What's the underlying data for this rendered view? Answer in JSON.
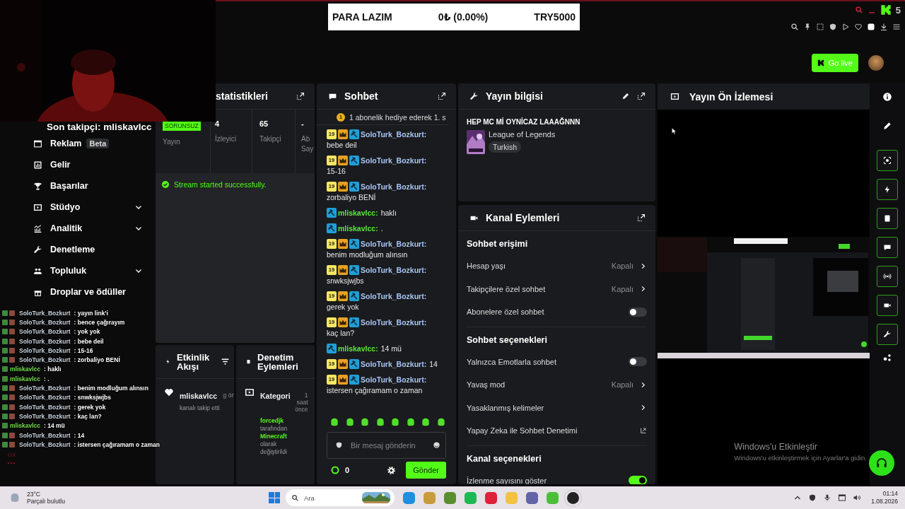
{
  "donation_goal": {
    "title": "PARA LAZIM",
    "progress": "0₺ (0.00%)",
    "goal": "TRY5000"
  },
  "browser": {
    "badge": "5"
  },
  "go_live": "Go live",
  "latest_follower": "Son takipçi: mliskavlcc",
  "sidebar": {
    "items": [
      {
        "label": "Reklam",
        "kind": "link",
        "badge": "Beta"
      },
      {
        "label": "Gelir",
        "kind": "link"
      },
      {
        "label": "Başarılar",
        "kind": "link"
      },
      {
        "label": "Stüdyo",
        "kind": "group"
      },
      {
        "label": "Analitik",
        "kind": "group"
      },
      {
        "label": "Denetleme",
        "kind": "link"
      },
      {
        "label": "Topluluk",
        "kind": "group"
      },
      {
        "label": "Droplar ve ödüller",
        "kind": "link"
      }
    ]
  },
  "stats": {
    "title": "statistikleri",
    "items": [
      {
        "kind": "status",
        "value": "SORUNSUZ",
        "label": "Yayın"
      },
      {
        "kind": "number",
        "value": "4",
        "label": "İzleyici"
      },
      {
        "kind": "number",
        "value": "65",
        "label": "Takipçi"
      },
      {
        "kind": "number",
        "value": "-",
        "label": "Ab Say"
      }
    ],
    "notice": "Stream started successfully."
  },
  "activity_feed": {
    "title": "Etkinlik Akışı",
    "events": [
      {
        "user": "mliskavlcc",
        "time": "g ön",
        "text": "kanalı takip etti"
      }
    ]
  },
  "mod_actions": {
    "title": "Denetim Eylemleri",
    "events": [
      {
        "title": "Kategori",
        "time": "1 saat önce",
        "text": "**forcedjk** tarafından **Minecraft** olarak değiştirildi"
      }
    ]
  },
  "chat": {
    "title": "Sohbet",
    "pinned": {
      "badge": "1",
      "text": "1 abonelik hediye ederek 1. s"
    },
    "messages": [
      {
        "user": "SoloTurk_Bozkurt:",
        "color": "#a9c6f5",
        "text": "bebe deil",
        "badges": [
          {
            "kind": "sub",
            "text": "19"
          },
          {
            "kind": "crown"
          },
          {
            "kind": "mod"
          }
        ]
      },
      {
        "user": "SoloTurk_Bozkurt:",
        "color": "#a9c6f5",
        "text": "15-16",
        "badges": [
          {
            "kind": "sub",
            "text": "19"
          },
          {
            "kind": "crown"
          },
          {
            "kind": "mod"
          }
        ]
      },
      {
        "user": "SoloTurk_Bozkurt:",
        "color": "#a9c6f5",
        "text": "zorbaliyo BENİ",
        "badges": [
          {
            "kind": "sub",
            "text": "19"
          },
          {
            "kind": "crown"
          },
          {
            "kind": "mod"
          }
        ]
      },
      {
        "user": "mliskavlcc:",
        "color": "#5ee83a",
        "text": "haklı",
        "badges": [
          {
            "kind": "mod"
          }
        ]
      },
      {
        "user": "mliskavlcc:",
        "color": "#5ee83a",
        "text": ".",
        "badges": [
          {
            "kind": "mod"
          }
        ]
      },
      {
        "user": "SoloTurk_Bozkurt:",
        "color": "#a9c6f5",
        "text": "benim modluğum alınsın",
        "badges": [
          {
            "kind": "sub",
            "text": "19"
          },
          {
            "kind": "crown"
          },
          {
            "kind": "mod"
          }
        ]
      },
      {
        "user": "SoloTurk_Bozkurt:",
        "color": "#a9c6f5",
        "text": "snwksjwjbs",
        "badges": [
          {
            "kind": "sub",
            "text": "19"
          },
          {
            "kind": "crown"
          },
          {
            "kind": "mod"
          }
        ]
      },
      {
        "user": "SoloTurk_Bozkurt:",
        "color": "#a9c6f5",
        "text": "gerek yok",
        "badges": [
          {
            "kind": "sub",
            "text": "19"
          },
          {
            "kind": "crown"
          },
          {
            "kind": "mod"
          }
        ]
      },
      {
        "user": "SoloTurk_Bozkurt:",
        "color": "#a9c6f5",
        "text": "kaç lan?",
        "badges": [
          {
            "kind": "sub",
            "text": "19"
          },
          {
            "kind": "crown"
          },
          {
            "kind": "mod"
          }
        ]
      },
      {
        "user": "mliskavlcc:",
        "color": "#5ee83a",
        "text": "14 mü",
        "badges": [
          {
            "kind": "mod"
          }
        ]
      },
      {
        "user": "SoloTurk_Bozkurt:",
        "color": "#a9c6f5",
        "text": "14",
        "badges": [
          {
            "kind": "sub",
            "text": "19"
          },
          {
            "kind": "crown"
          },
          {
            "kind": "mod"
          }
        ]
      },
      {
        "user": "SoloTurk_Bozkurt:",
        "color": "#a9c6f5",
        "text": "istersen çağıramam o zaman",
        "badges": [
          {
            "kind": "sub",
            "text": "19"
          },
          {
            "kind": "crown"
          },
          {
            "kind": "mod"
          }
        ]
      }
    ],
    "input": {
      "placeholder": "Bir mesaj gönderin"
    },
    "points": "0",
    "send": "Gönder"
  },
  "stream_info": {
    "title": "Yayın bilgisi",
    "stream_title": "HEP MC Mİ OYNİCAZ LAAAĞNNN",
    "category": "League of Legends",
    "tags": [
      "Turkish"
    ]
  },
  "channel_actions": {
    "title": "Kanal Eylemleri",
    "sections": [
      {
        "title": "Sohbet erişimi",
        "rows": [
          {
            "kind": "select",
            "label": "Hesap yaşı",
            "value": "Kapalı"
          },
          {
            "kind": "select",
            "label": "Takipçilere özel sohbet",
            "value": "Kapalı"
          },
          {
            "kind": "toggle",
            "label": "Abonelere özel sohbet",
            "on": false
          }
        ]
      },
      {
        "title": "Sohbet seçenekleri",
        "rows": [
          {
            "kind": "toggle",
            "label": "Yalnızca Emotlarla sohbet",
            "on": false
          },
          {
            "kind": "select",
            "label": "Yavaş mod",
            "value": "Kapalı"
          },
          {
            "kind": "link",
            "label": "Yasaklanmış kelimeler"
          },
          {
            "kind": "external",
            "label": "Yapay Zeka ile Sohbet Denetimi"
          }
        ]
      },
      {
        "title": "Kanal seçenekleri",
        "rows": [
          {
            "kind": "toggle",
            "label": "İzlenme sayısını göster",
            "on": true
          }
        ]
      }
    ]
  },
  "preview": {
    "title": "Yayın Ön İzlemesi"
  },
  "activation_notice": {
    "title": "Windows'u Etkinleştir",
    "text": "Windows'u etkinleştirmek için Ayarlar'a gidin."
  },
  "overlay_chat": [
    {
      "kind": "subscriber",
      "user": "SoloTurk_Bozkurt",
      "color": "#c9d3dc",
      "text": ": yayın link'i"
    },
    {
      "kind": "subscriber",
      "user": "SoloTurk_Bozkurt",
      "color": "#c9d3dc",
      "text": ": bence çağırayım"
    },
    {
      "kind": "subscriber",
      "user": "SoloTurk_Bozkurt",
      "color": "#c9d3dc",
      "text": ": yok yok"
    },
    {
      "kind": "subscriber",
      "user": "SoloTurk_Bozkurt",
      "color": "#c9d3dc",
      "text": ": bebe deil"
    },
    {
      "kind": "subscriber",
      "user": "SoloTurk_Bozkurt",
      "color": "#c9d3dc",
      "text": ": 15-16"
    },
    {
      "kind": "subscriber",
      "user": "SoloTurk_Bozkurt",
      "color": "#c9d3dc",
      "text": ": zorbaliyo BENİ"
    },
    {
      "kind": "moderator",
      "user": "mliskavlcc",
      "color": "#75e04f",
      "text": ": haklı"
    },
    {
      "kind": "moderator",
      "user": "mliskavlcc",
      "color": "#75e04f",
      "text": ": ."
    },
    {
      "kind": "subscriber",
      "user": "SoloTurk_Bozkurt",
      "color": "#c9d3dc",
      "text": ": benim modluğum alınsın"
    },
    {
      "kind": "subscriber",
      "user": "SoloTurk_Bozkurt",
      "color": "#c9d3dc",
      "text": ": snwksjwjbs"
    },
    {
      "kind": "subscriber",
      "user": "SoloTurk_Bozkurt",
      "color": "#c9d3dc",
      "text": ": gerek yok"
    },
    {
      "kind": "subscriber",
      "user": "SoloTurk_Bozkurt",
      "color": "#c9d3dc",
      "text": ": kaç lan?"
    },
    {
      "kind": "moderator",
      "user": "mliskavlcc",
      "color": "#75e04f",
      "text": ": 14 mü"
    },
    {
      "kind": "subscriber",
      "user": "SoloTurk_Bozkurt",
      "color": "#c9d3dc",
      "text": ": 14"
    },
    {
      "kind": "subscriber",
      "user": "SoloTurk_Bozkurt",
      "color": "#c9d3dc",
      "text": ": istersen çağıramam o zaman"
    }
  ],
  "browser_sidebar": {
    "label": "GX"
  },
  "taskbar": {
    "weather": {
      "temperature": "23°C",
      "condition": "Parçalı bulutlu"
    },
    "search": {
      "placeholder": "Ara"
    },
    "time": "01:14",
    "date": "1.08.2026"
  }
}
